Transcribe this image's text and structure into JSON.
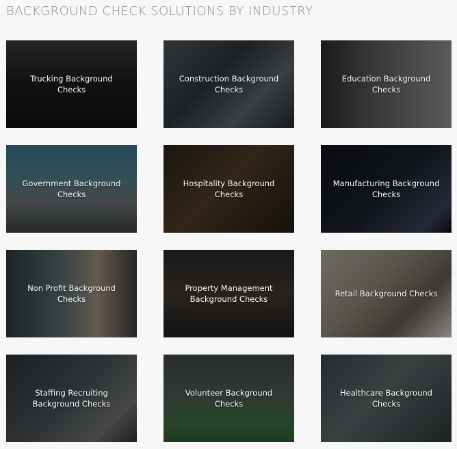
{
  "page_title": "BACKGROUND CHECK SOLUTIONS BY INDUSTRY",
  "tiles": [
    {
      "label": "Trucking Background Checks"
    },
    {
      "label": "Construction Background Checks"
    },
    {
      "label": "Education Background Checks"
    },
    {
      "label": "Government Background Checks"
    },
    {
      "label": "Hospitality Background Checks"
    },
    {
      "label": "Manufacturing Background Checks"
    },
    {
      "label": "Non Profit Background Checks"
    },
    {
      "label": "Property Management Background Checks"
    },
    {
      "label": "Retail Background Checks"
    },
    {
      "label": "Staffing Recruiting Background Checks"
    },
    {
      "label": "Volunteer Background Checks"
    },
    {
      "label": "Healthcare Background Checks"
    }
  ]
}
